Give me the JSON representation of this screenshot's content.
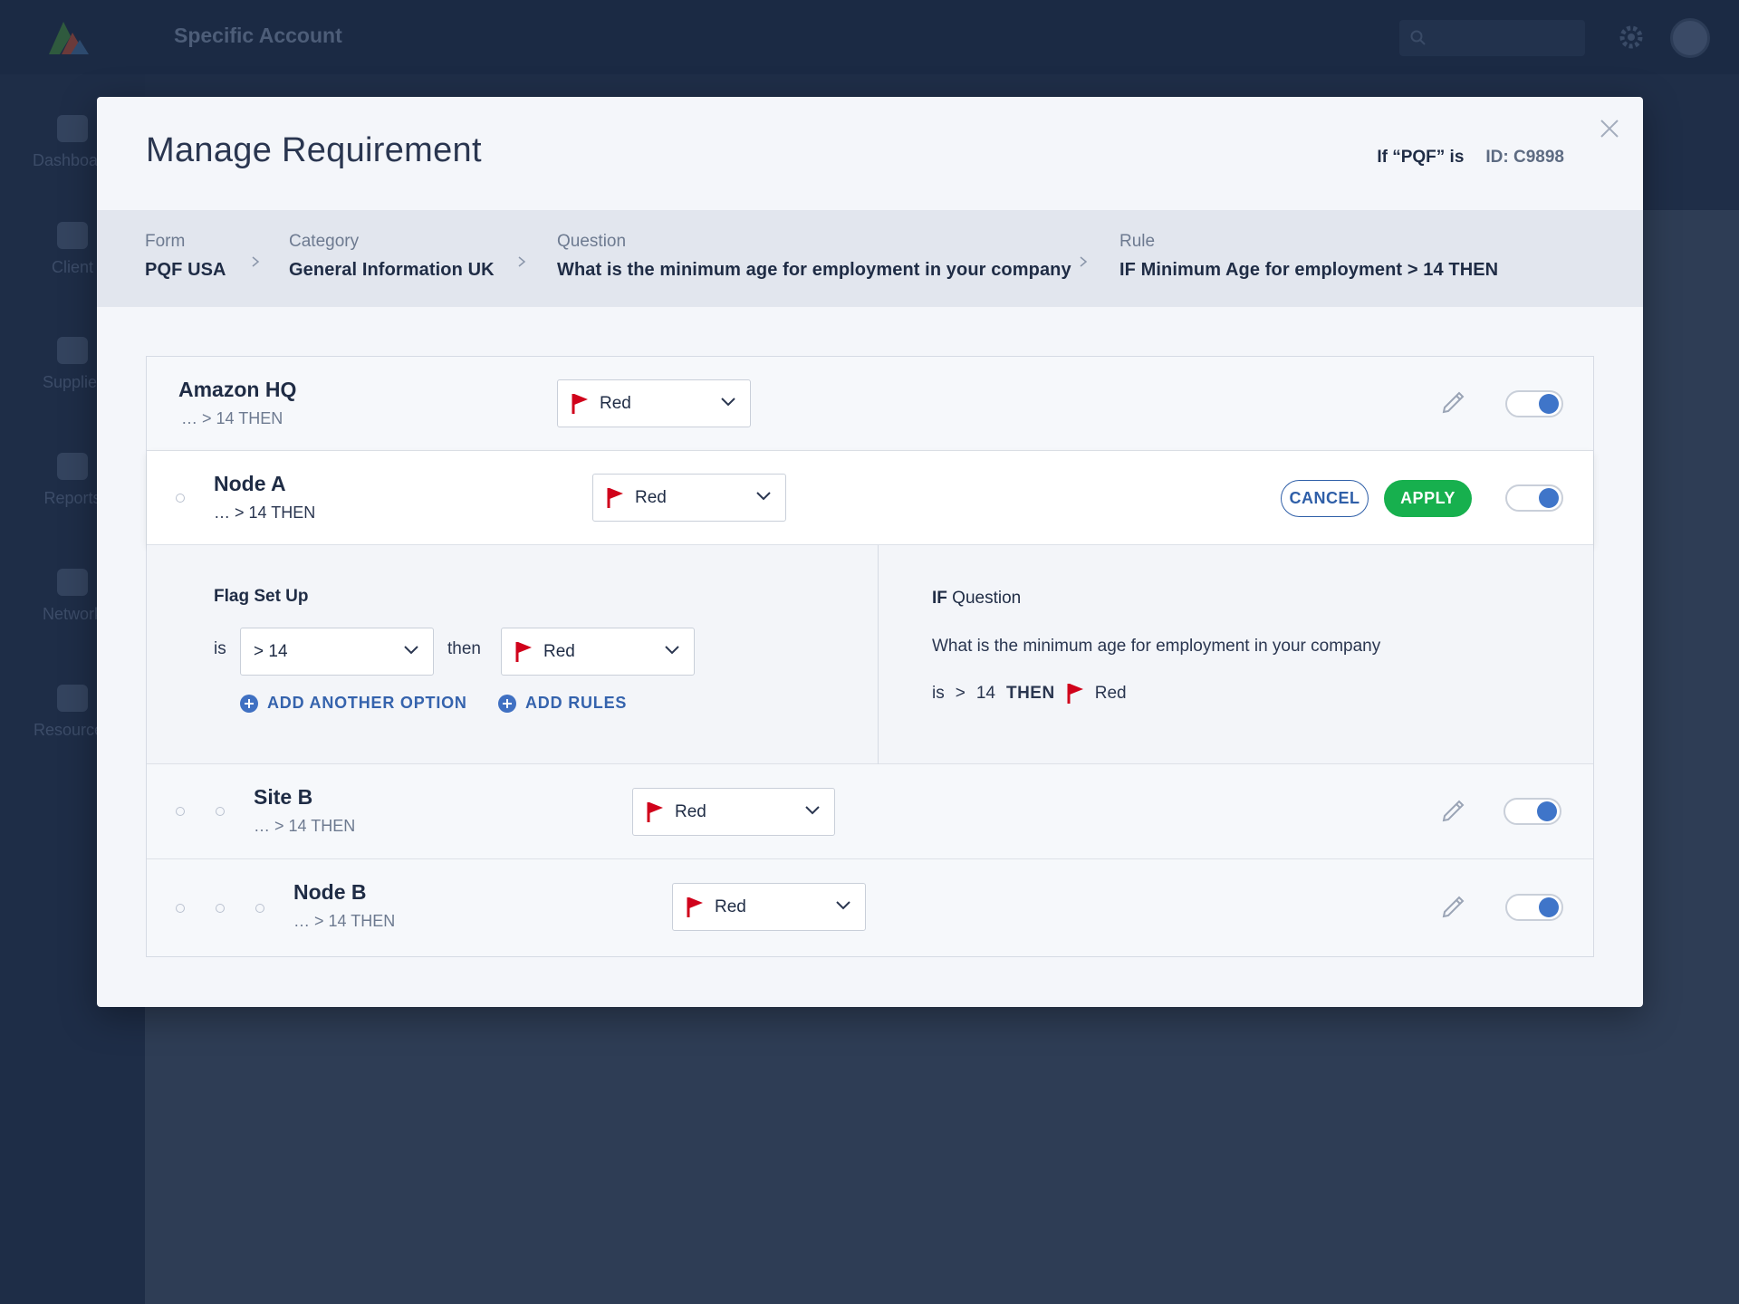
{
  "background": {
    "app_title": "Specific Account",
    "nav_items": [
      "Dashboard",
      "Client",
      "Supplier",
      "Reports",
      "Network",
      "Resources"
    ]
  },
  "modal": {
    "title": "Manage Requirement",
    "meta_if": "If “PQF” is",
    "meta_id": "ID: C9898"
  },
  "breadcrumb": [
    {
      "label": "Form",
      "value": "PQF USA"
    },
    {
      "label": "Category",
      "value": "General Information UK"
    },
    {
      "label": "Question",
      "value": "What is the minimum age for employment in your company"
    },
    {
      "label": "Rule",
      "value": "IF Minimum Age for employment > 14 THEN"
    }
  ],
  "rows": [
    {
      "name": "Amazon HQ",
      "sub": "… > 14 THEN",
      "flag": "Red"
    },
    {
      "name": "Node A",
      "sub": "… > 14 THEN",
      "flag": "Red"
    },
    {
      "name": "Site B",
      "sub": "… > 14 THEN",
      "flag": "Red"
    },
    {
      "name": "Node B",
      "sub": "… > 14 THEN",
      "flag": "Red"
    }
  ],
  "actions": {
    "cancel": "CANCEL",
    "apply": "APPLY"
  },
  "flag_setup": {
    "title": "Flag Set Up",
    "is_label": "is",
    "condition_value": "> 14",
    "then_label": "then",
    "flag_value": "Red",
    "add_option": "ADD ANOTHER OPTION",
    "add_rules": "ADD RULES"
  },
  "if_question": {
    "title_bold": "IF",
    "title_rest": " Question",
    "question": "What is the minimum age for employment in your company",
    "is": "is",
    "op": ">",
    "num": "14",
    "then": "THEN",
    "flag": "Red"
  },
  "colors": {
    "flag": "#d0021b",
    "apply": "#17b04e",
    "toggle_on": "#3f75c9",
    "link": "#3563ad"
  }
}
